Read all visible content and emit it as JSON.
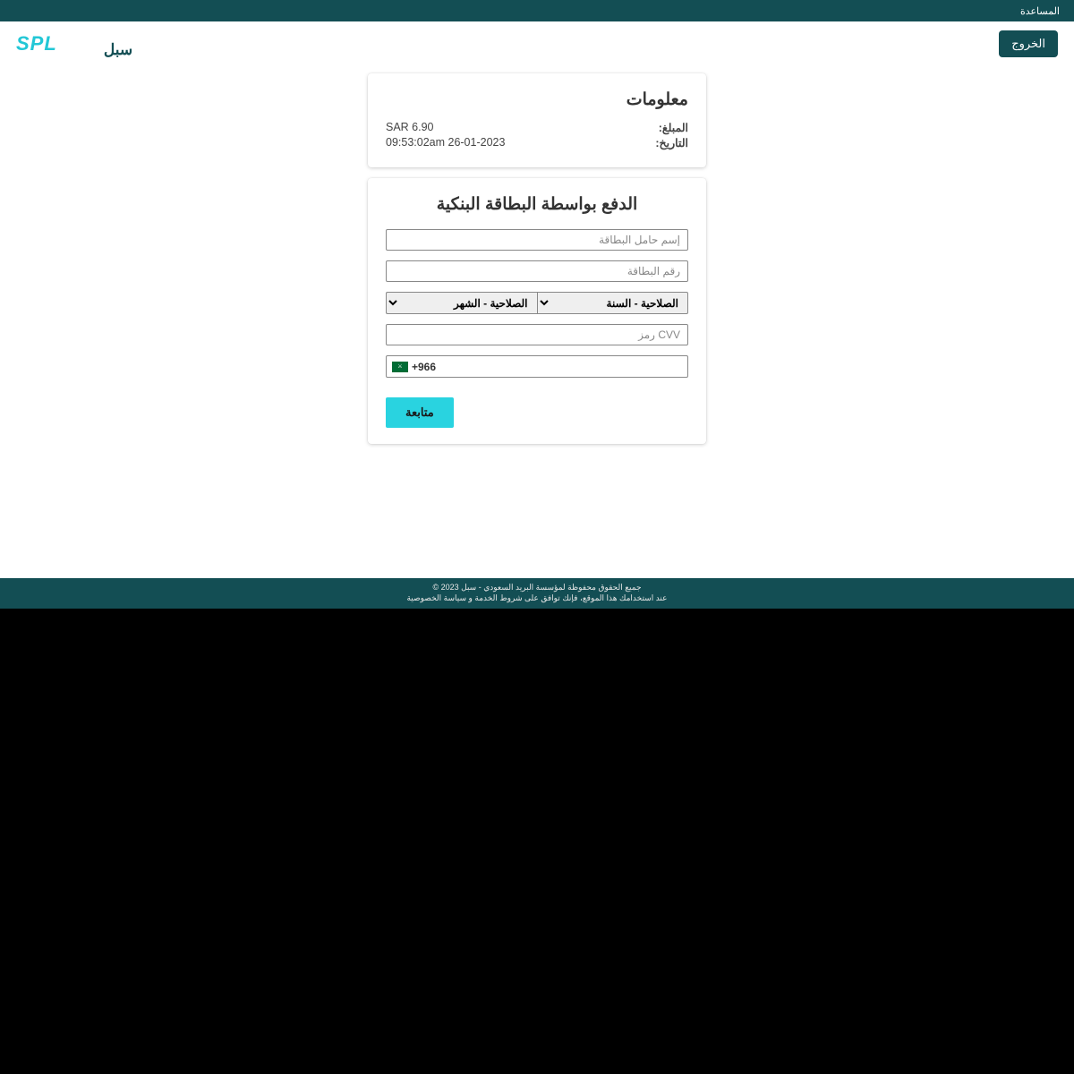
{
  "topbar": {
    "help": "المساعدة"
  },
  "header": {
    "exit": "الخروج",
    "logo_en": "SPL",
    "logo_ar": "سبل"
  },
  "info": {
    "title": "معلومات",
    "amount_label": "المبلغ:",
    "amount_value": "SAR 6.90",
    "date_label": "التاريخ:",
    "date_value": "09:53:02am 26-01-2023"
  },
  "payment": {
    "title": "الدفع بواسطة البطاقة البنكية",
    "cardholder_placeholder": "إسم حامل البطاقة",
    "cardnumber_placeholder": "رقم البطاقة",
    "expiry_year": "الصلاحية - السنة",
    "expiry_month": "الصلاحية - الشهر",
    "cvv_placeholder": "CVV رمز",
    "dial_code": "+966",
    "continue": "متابعة"
  },
  "footer": {
    "line1": "جميع الحقوق محفوظة لمؤسسة البريد السعودي - سبل 2023 ©",
    "line2_prefix": "عند استخدامك هذا الموقع، فإنك توافق على ",
    "terms": "شروط الخدمة",
    "and": " و ",
    "privacy": "سياسة الخصوصية"
  }
}
